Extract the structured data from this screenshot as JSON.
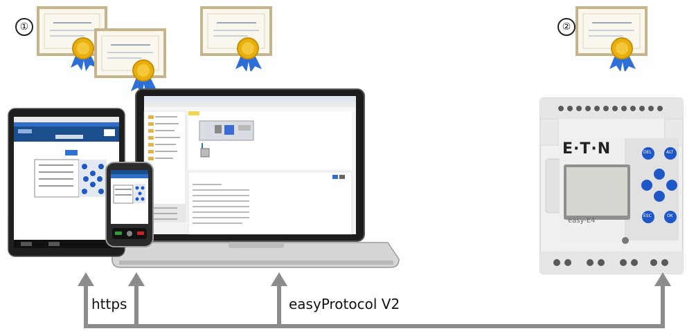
{
  "labels": {
    "badge_1": "①",
    "badge_2": "②",
    "https": "https",
    "protocol": "easyProtocol V2",
    "device_brand": "E·T·N",
    "device_model": "easy-E4"
  },
  "device_buttons": [
    "DEL",
    "ALT",
    "ESC",
    "OK"
  ],
  "colors": {
    "arrow": "#8c8c8c",
    "gold": "#e8b00e",
    "ribbon": "#2d6fd6",
    "cert_border": "#c8b48a",
    "blue_key": "#1e58c8"
  },
  "icons": [
    "certificate-icon",
    "tablet-icon",
    "smartphone-icon",
    "laptop-icon",
    "plc-device-icon",
    "arrow-up-icon"
  ]
}
